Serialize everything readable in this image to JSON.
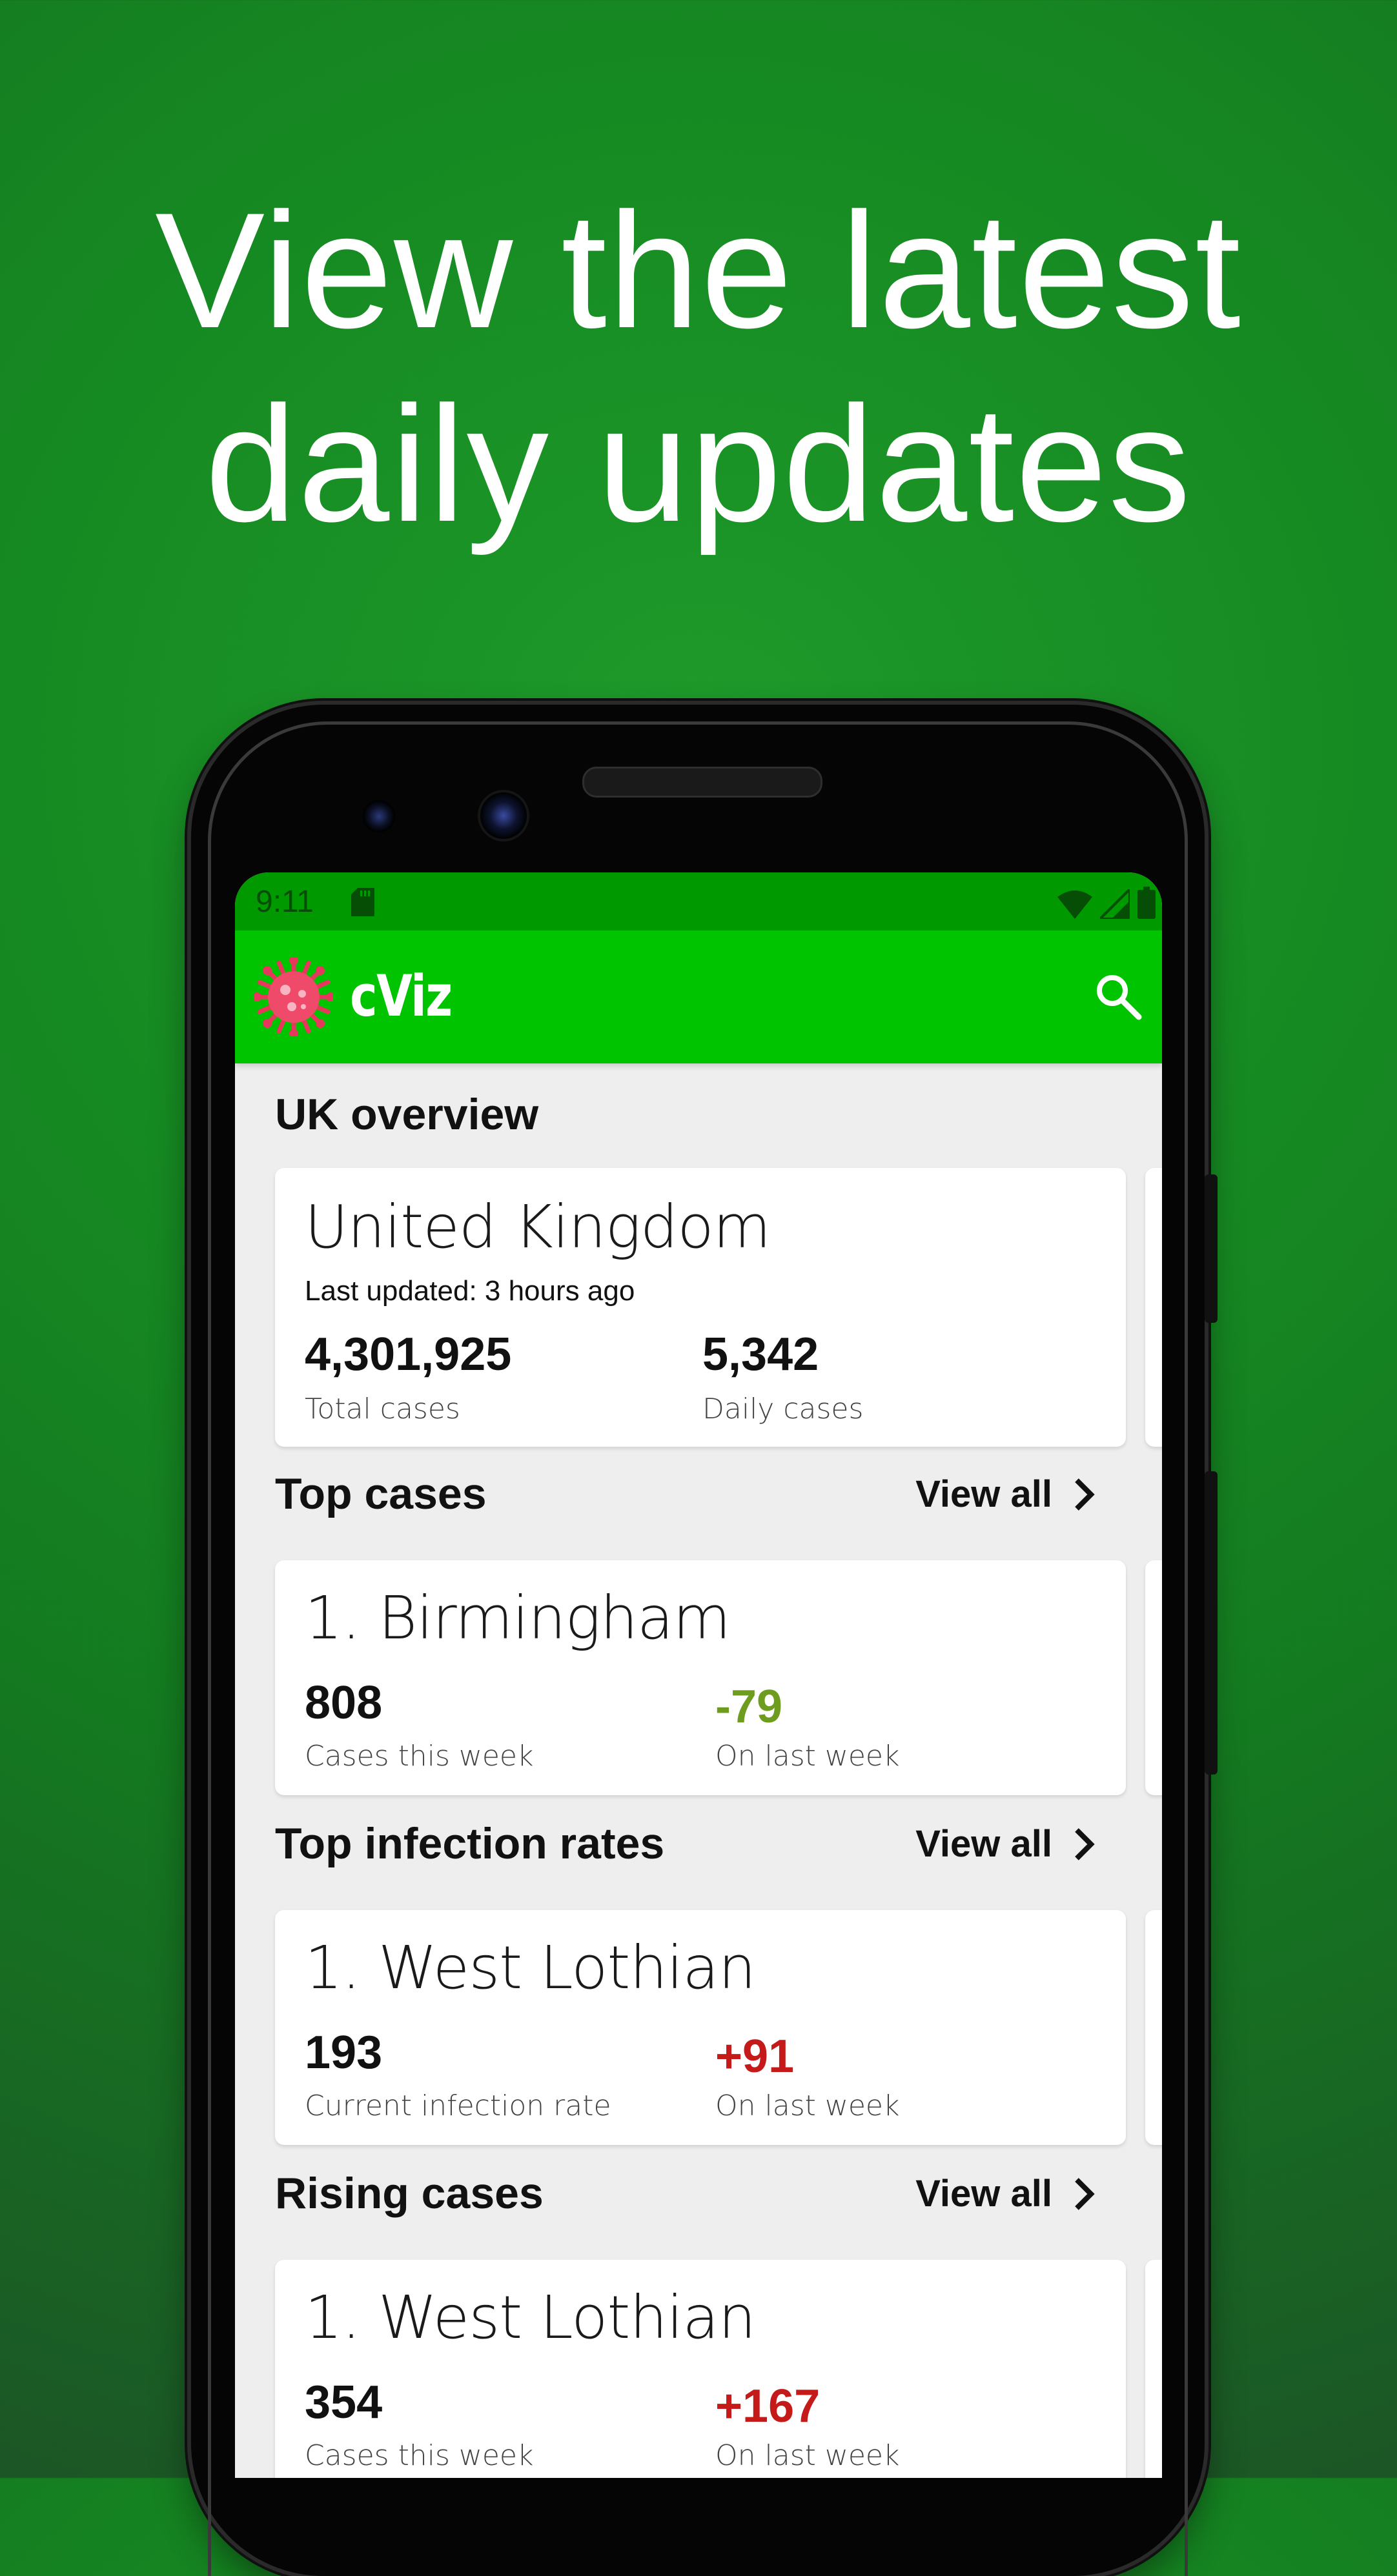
{
  "headline": [
    "View the latest",
    "daily updates"
  ],
  "status_bar": {
    "time": "9:11"
  },
  "app": {
    "name": "cViz",
    "logo_icon": "virus-icon",
    "search_icon": "search-icon",
    "bar_color": "#00c400",
    "status_color": "#009a00"
  },
  "uk_overview": {
    "heading": "UK overview",
    "country": "United Kingdom",
    "last_updated": "Last updated: 3 hours ago",
    "total_cases": "4,301,925",
    "total_cases_label": "Total cases",
    "daily_cases": "5,342",
    "daily_cases_label": "Daily cases"
  },
  "top_cases": {
    "heading": "Top cases",
    "view_all": "View all",
    "item": {
      "rank": "1.",
      "name": "Birmingham",
      "value": "808",
      "value_label": "Cases this week",
      "change": "-79",
      "change_label": "On last week"
    }
  },
  "top_infection_rates": {
    "heading": "Top infection rates",
    "view_all": "View all",
    "item": {
      "rank": "1.",
      "name": "West Lothian",
      "value": "193",
      "value_label": "Current infection rate",
      "change": "+91",
      "change_label": "On last week"
    }
  },
  "rising_cases": {
    "heading": "Rising cases",
    "view_all": "View all",
    "item": {
      "rank": "1.",
      "name": "West Lothian",
      "value": "354",
      "value_label": "Cases this week",
      "change": "+167",
      "change_label": "On last week"
    }
  },
  "colors": {
    "decrease": "#6e9c1f",
    "increase": "#c41a1a"
  }
}
